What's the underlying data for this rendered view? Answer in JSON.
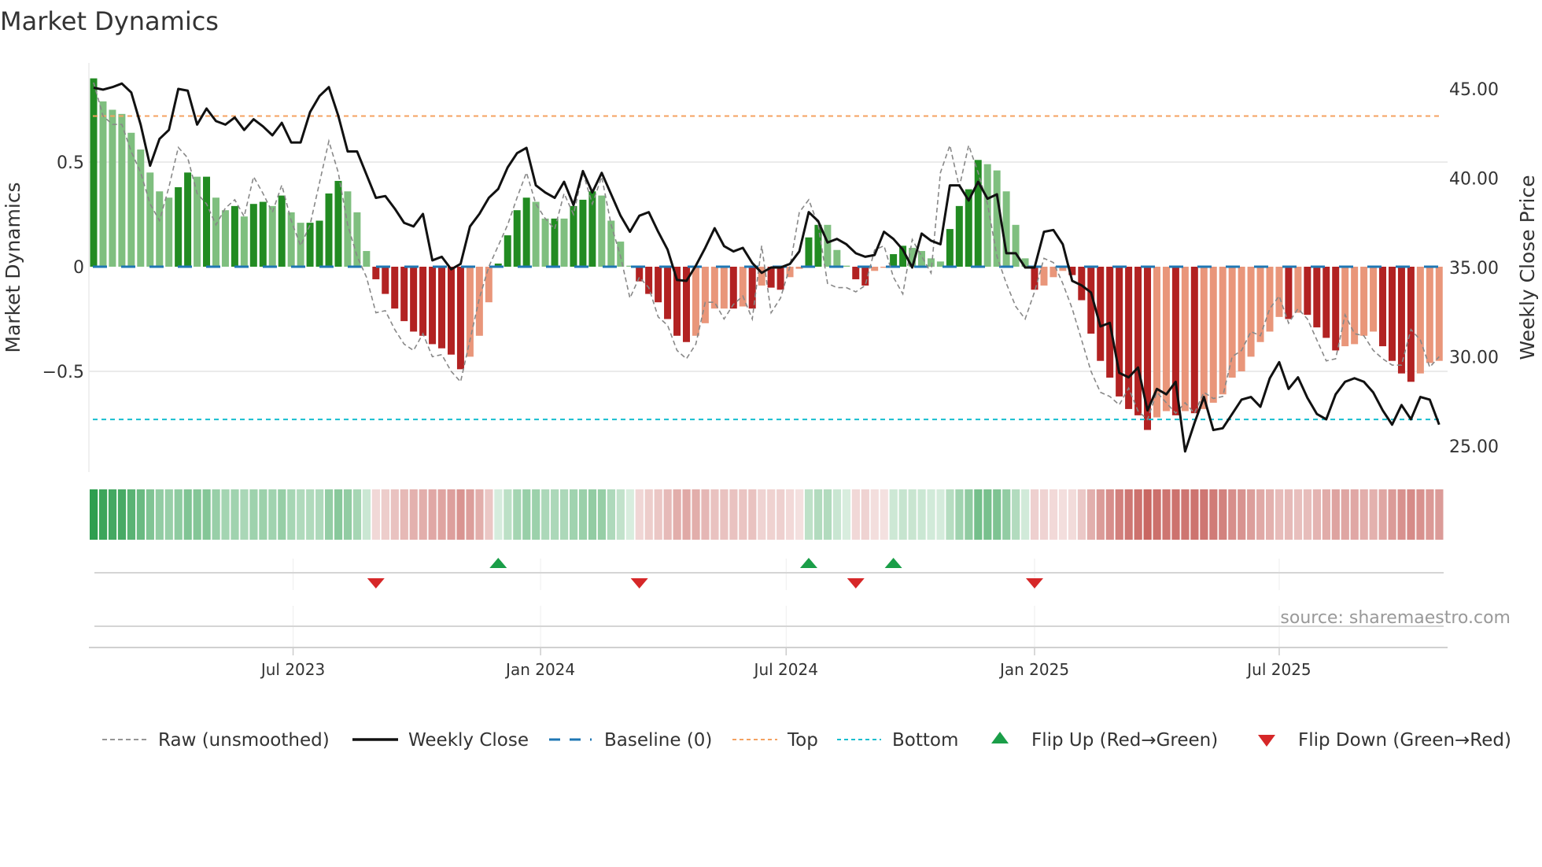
{
  "chart_data": {
    "type": "bar",
    "title": "Market Dynamics",
    "ylabel": "Market Dynamics",
    "y2label": "Weekly Close Price",
    "ylim": [
      -1.0,
      1.0
    ],
    "y2lim": [
      24.0,
      46.5
    ],
    "yticks": [
      {
        "value": 0.5,
        "label": "0.5"
      },
      {
        "value": 0,
        "label": "0"
      },
      {
        "value": -0.5,
        "label": "−0.5"
      }
    ],
    "y2ticks": [
      {
        "value": 45,
        "label": "45.00"
      },
      {
        "value": 40,
        "label": "40.00"
      },
      {
        "value": 35,
        "label": "35.00"
      },
      {
        "value": 30,
        "label": "30.00"
      },
      {
        "value": 25,
        "label": "25.00"
      }
    ],
    "xticks": [
      {
        "week": 21.2,
        "label": "Jul 2023"
      },
      {
        "week": 47.5,
        "label": "Jan 2024"
      },
      {
        "week": 73.6,
        "label": "Jul 2024"
      },
      {
        "week": 100,
        "label": "Jan 2025"
      },
      {
        "week": 126,
        "label": "Jul 2025"
      }
    ],
    "top_level": 0.72,
    "bottom_level": -0.73,
    "baseline": 0,
    "dynamics": [
      0.9,
      0.79,
      0.75,
      0.73,
      0.64,
      0.56,
      0.45,
      0.36,
      0.33,
      0.38,
      0.45,
      0.43,
      0.43,
      0.33,
      0.27,
      0.29,
      0.24,
      0.3,
      0.31,
      0.29,
      0.34,
      0.26,
      0.21,
      0.21,
      0.22,
      0.35,
      0.41,
      0.36,
      0.26,
      0.075,
      -0.06,
      -0.13,
      -0.2,
      -0.26,
      -0.31,
      -0.33,
      -0.37,
      -0.39,
      -0.42,
      -0.49,
      -0.43,
      -0.33,
      -0.17,
      0.015,
      0.15,
      0.27,
      0.33,
      0.31,
      0.23,
      0.23,
      0.23,
      0.29,
      0.32,
      0.36,
      0.34,
      0.22,
      0.12,
      0.005,
      -0.07,
      -0.13,
      -0.17,
      -0.25,
      -0.33,
      -0.36,
      -0.33,
      -0.27,
      -0.2,
      -0.2,
      -0.2,
      -0.19,
      -0.2,
      -0.09,
      -0.1,
      -0.11,
      -0.05,
      -0.01,
      0.14,
      0.2,
      0.2,
      0.08,
      0.005,
      -0.06,
      -0.09,
      -0.02,
      -0.005,
      0.06,
      0.1,
      0.09,
      0.075,
      0.04,
      0.025,
      0.18,
      0.29,
      0.37,
      0.51,
      0.49,
      0.46,
      0.36,
      0.2,
      0.04,
      -0.11,
      -0.09,
      -0.05,
      -0.02,
      -0.04,
      -0.16,
      -0.32,
      -0.45,
      -0.53,
      -0.62,
      -0.68,
      -0.71,
      -0.78,
      -0.72,
      -0.69,
      -0.71,
      -0.69,
      -0.7,
      -0.68,
      -0.65,
      -0.61,
      -0.53,
      -0.5,
      -0.43,
      -0.36,
      -0.31,
      -0.24,
      -0.25,
      -0.22,
      -0.23,
      -0.29,
      -0.34,
      -0.4,
      -0.38,
      -0.37,
      -0.33,
      -0.31,
      -0.38,
      -0.45,
      -0.51,
      -0.55,
      -0.51,
      -0.46,
      -0.45
    ],
    "strengthening": "DLLLLLLLLDDLDLLDLDDLDLLDDDDLLLDDDDDDDDDDLLLDDDDLLDLDDDLLLLDDDDDDLLLLDLDLDDLLDDLLLDDLLDDLLLLDDDDLLLLLDLLLDDDDDDDDDLLDLDLLLLLLLLLDLDDDDLLLLDDDDLLL",
    "raw": [
      0.88,
      0.72,
      0.68,
      0.68,
      0.55,
      0.45,
      0.3,
      0.22,
      0.38,
      0.57,
      0.52,
      0.35,
      0.3,
      0.2,
      0.28,
      0.32,
      0.24,
      0.43,
      0.35,
      0.26,
      0.39,
      0.22,
      0.1,
      0.2,
      0.4,
      0.6,
      0.45,
      0.2,
      0.05,
      -0.05,
      -0.22,
      -0.21,
      -0.3,
      -0.37,
      -0.4,
      -0.32,
      -0.43,
      -0.42,
      -0.5,
      -0.55,
      -0.35,
      -0.15,
      0.0,
      0.1,
      0.2,
      0.33,
      0.45,
      0.3,
      0.23,
      0.18,
      0.35,
      0.25,
      0.45,
      0.3,
      0.43,
      0.2,
      0.05,
      -0.15,
      -0.05,
      -0.1,
      -0.24,
      -0.28,
      -0.4,
      -0.44,
      -0.37,
      -0.17,
      -0.17,
      -0.25,
      -0.18,
      -0.14,
      -0.25,
      0.1,
      -0.22,
      -0.15,
      0.0,
      0.26,
      0.32,
      0.2,
      -0.08,
      -0.1,
      -0.1,
      -0.12,
      -0.09,
      0.08,
      0.1,
      -0.05,
      -0.13,
      0.13,
      0.05,
      -0.03,
      0.45,
      0.58,
      0.38,
      0.58,
      0.45,
      0.3,
      0.05,
      -0.08,
      -0.19,
      -0.25,
      -0.12,
      0.04,
      0.02,
      -0.08,
      -0.2,
      -0.35,
      -0.5,
      -0.6,
      -0.62,
      -0.66,
      -0.58,
      -0.69,
      -0.73,
      -0.6,
      -0.65,
      -0.7,
      -0.65,
      -0.7,
      -0.6,
      -0.63,
      -0.62,
      -0.43,
      -0.4,
      -0.31,
      -0.33,
      -0.2,
      -0.14,
      -0.27,
      -0.2,
      -0.25,
      -0.35,
      -0.45,
      -0.44,
      -0.23,
      -0.32,
      -0.33,
      -0.4,
      -0.44,
      -0.47,
      -0.47,
      -0.3,
      -0.35,
      -0.48,
      -0.43
    ],
    "weekly_close": [
      45.07,
      44.96,
      45.1,
      45.3,
      44.8,
      43.0,
      40.7,
      42.2,
      42.7,
      45.0,
      44.9,
      43.0,
      43.9,
      43.2,
      43.0,
      43.4,
      42.7,
      43.3,
      42.9,
      42.4,
      43.1,
      42.0,
      42.0,
      43.7,
      44.6,
      45.1,
      43.5,
      41.5,
      41.5,
      40.2,
      38.9,
      39.0,
      38.3,
      37.5,
      37.3,
      38.0,
      35.4,
      35.6,
      34.9,
      35.2,
      37.3,
      38.0,
      38.9,
      39.4,
      40.6,
      41.4,
      41.7,
      39.6,
      39.2,
      38.9,
      39.8,
      38.5,
      40.4,
      39.2,
      40.3,
      39.1,
      37.9,
      37.0,
      37.9,
      38.1,
      37.0,
      36.0,
      34.3,
      34.25,
      35.1,
      36.1,
      37.2,
      36.2,
      35.9,
      36.1,
      35.25,
      34.7,
      35.0,
      35.0,
      35.2,
      35.9,
      38.1,
      37.6,
      36.4,
      36.6,
      36.3,
      35.8,
      35.6,
      35.7,
      37.0,
      36.6,
      36.0,
      35.0,
      36.9,
      36.5,
      36.3,
      39.6,
      39.6,
      38.75,
      39.8,
      38.85,
      39.1,
      35.8,
      35.8,
      35.0,
      35.0,
      37.0,
      37.1,
      36.3,
      34.25,
      34.0,
      33.6,
      31.7,
      31.9,
      29.1,
      28.85,
      29.4,
      27.0,
      28.2,
      27.9,
      28.6,
      24.7,
      26.3,
      27.75,
      25.9,
      26.0,
      26.8,
      27.6,
      27.75,
      27.2,
      28.8,
      29.7,
      28.2,
      28.85,
      27.7,
      26.8,
      26.5,
      27.9,
      28.6,
      28.8,
      28.6,
      28.0,
      27.0,
      26.2,
      27.3,
      26.5,
      27.75,
      27.6,
      26.2
    ],
    "flips": [
      {
        "week": 31,
        "type": "down"
      },
      {
        "week": 44,
        "type": "up"
      },
      {
        "week": 59,
        "type": "down"
      },
      {
        "week": 77,
        "type": "up"
      },
      {
        "week": 82,
        "type": "down"
      },
      {
        "week": 86,
        "type": "up"
      },
      {
        "week": 101,
        "type": "down"
      }
    ],
    "legend": [
      {
        "key": "raw",
        "label": "Raw (unsmoothed)"
      },
      {
        "key": "close",
        "label": "Weekly Close"
      },
      {
        "key": "baseline",
        "label": "Baseline (0)"
      },
      {
        "key": "top",
        "label": "Top"
      },
      {
        "key": "bottom",
        "label": "Bottom"
      },
      {
        "key": "flipup",
        "label": "Flip Up (Red→Green)"
      },
      {
        "key": "flipdown",
        "label": "Flip Down (Green→Red)"
      }
    ],
    "legend_position": "bottom",
    "source": "source: sharemaestro.com",
    "colors": {
      "green_strong": "#228b22",
      "green_weak": "#7fbf7f",
      "red_strong": "#b22222",
      "red_weak": "#e9967a",
      "raw": "#888888",
      "close": "#111111",
      "baseline": "#1f77b4",
      "top": "#f4a261",
      "bottom": "#17becf",
      "flip_up": "#1a9e48",
      "flip_down": "#d62728"
    }
  }
}
